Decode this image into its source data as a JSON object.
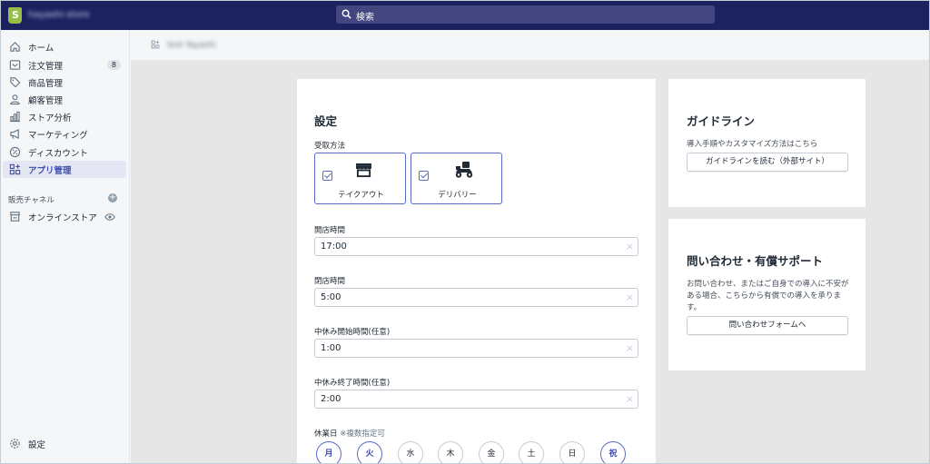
{
  "topbar": {
    "store_name": "hayashi-store",
    "search_placeholder": "検索",
    "brand_color": "#1c2260",
    "logo_icon": "shopify-bag-icon",
    "search_icon": "search-icon"
  },
  "sidebar": {
    "items": [
      {
        "label": "ホーム",
        "icon": "home-icon"
      },
      {
        "label": "注文管理",
        "icon": "orders-icon",
        "badge": "8"
      },
      {
        "label": "商品管理",
        "icon": "tag-icon"
      },
      {
        "label": "顧客管理",
        "icon": "person-icon"
      },
      {
        "label": "ストア分析",
        "icon": "bar-chart-icon"
      },
      {
        "label": "マーケティング",
        "icon": "megaphone-icon"
      },
      {
        "label": "ディスカウント",
        "icon": "discount-icon"
      },
      {
        "label": "アプリ管理",
        "icon": "apps-icon",
        "active": true
      }
    ],
    "channels_title": "販売チャネル",
    "channel_items": [
      {
        "label": "オンラインストア",
        "icon": "store-icon"
      }
    ],
    "settings_label": "設定",
    "accent_color": "#3f4eae"
  },
  "breadcrumb": {
    "text": "test Yayashi"
  },
  "settings_card": {
    "title": "設定",
    "pickup_label": "受取方法",
    "pickup_options": [
      {
        "label": "テイクアウト",
        "checked": true,
        "icon": "storefront-icon"
      },
      {
        "label": "デリバリー",
        "checked": true,
        "icon": "delivery-scooter-icon"
      }
    ],
    "fields": [
      {
        "label": "開店時間",
        "value": "17:00"
      },
      {
        "label": "閉店時間",
        "value": "5:00"
      },
      {
        "label": "中休み開始時間(任意)",
        "value": "1:00"
      },
      {
        "label": "中休み終了時間(任意)",
        "value": "2:00"
      }
    ],
    "holidays_label": "休業日",
    "holidays_note": "※複数指定可",
    "days": [
      {
        "label": "月",
        "selected": true
      },
      {
        "label": "火",
        "selected": true
      },
      {
        "label": "水",
        "selected": false
      },
      {
        "label": "木",
        "selected": false
      },
      {
        "label": "金",
        "selected": false
      },
      {
        "label": "土",
        "selected": false
      },
      {
        "label": "日",
        "selected": false
      },
      {
        "label": "祝",
        "selected": true
      }
    ]
  },
  "guide_card": {
    "title": "ガイドライン",
    "description": "導入手順やカスタマイズ方法はこちら",
    "button": "ガイドラインを読む（外部サイト）"
  },
  "support_card": {
    "title": "問い合わせ・有償サポート",
    "description_lines": [
      "お問い合わせ、またはご自身での導入に不安が",
      "ある場合、こちらから有償での導入を承りま",
      "す。"
    ],
    "button": "問い合わせフォームへ"
  }
}
